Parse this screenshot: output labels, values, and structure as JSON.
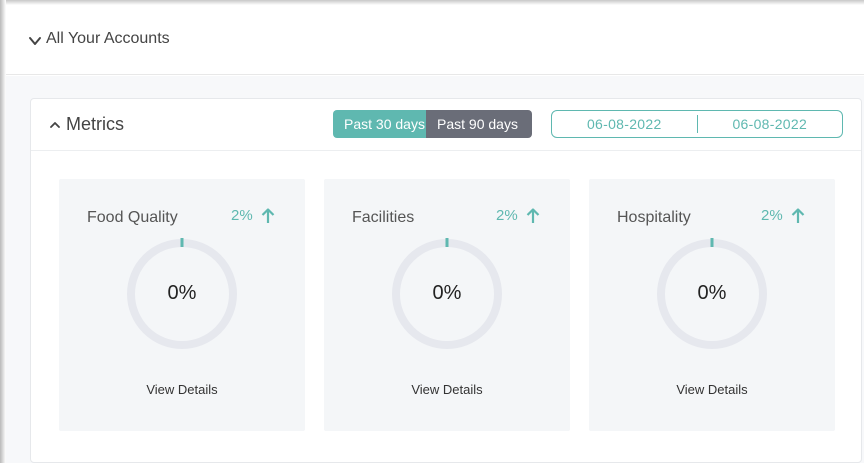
{
  "accounts": {
    "title": "All Your Accounts"
  },
  "metrics": {
    "title": "Metrics",
    "range_options": [
      {
        "label": "Past 30 days",
        "active": true
      },
      {
        "label": "Past 90 days",
        "active": false
      }
    ],
    "date_from": "06-08-2022",
    "date_to": "06-08-2022",
    "cards": [
      {
        "name": "Food Quality",
        "change": "2%",
        "value": "0%",
        "link": "View Details"
      },
      {
        "name": "Facilities",
        "change": "2%",
        "value": "0%",
        "link": "View Details"
      },
      {
        "name": "Hospitality",
        "change": "2%",
        "value": "0%",
        "link": "View Details"
      }
    ]
  },
  "colors": {
    "accent": "#5fb8b0",
    "inactive_toggle": "#6a6d78",
    "ring_track": "#e6e8ee"
  }
}
